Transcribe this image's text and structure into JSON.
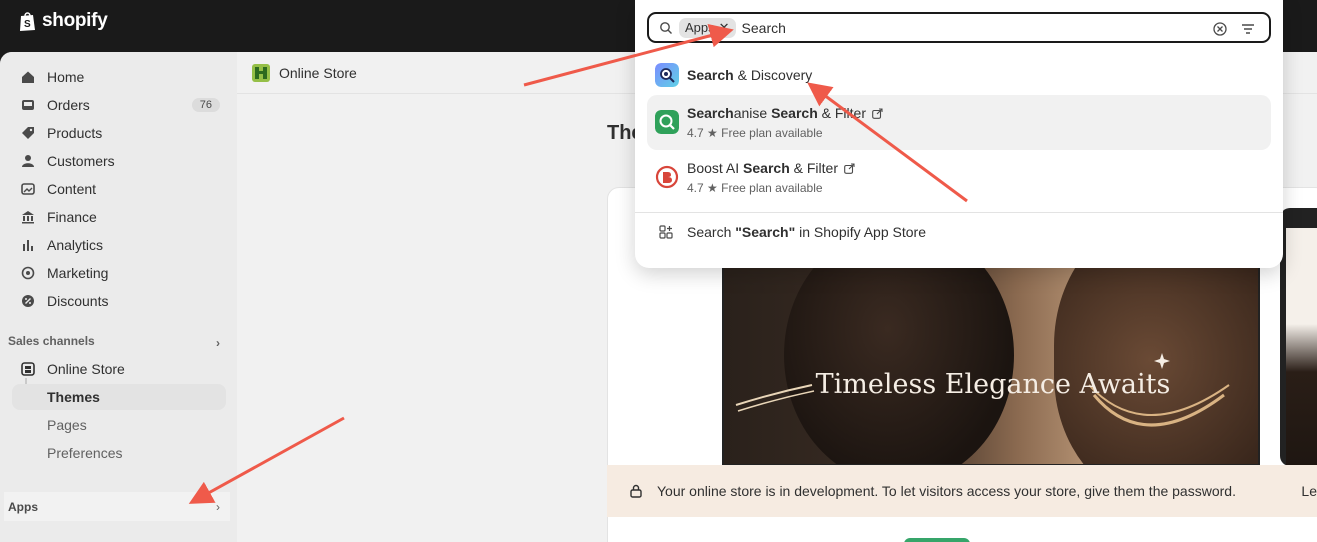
{
  "brand": {
    "name": "shopify"
  },
  "sidebar": {
    "items": [
      {
        "label": "Home",
        "icon": "home-icon"
      },
      {
        "label": "Orders",
        "icon": "inbox-icon",
        "badge": "76"
      },
      {
        "label": "Products",
        "icon": "tag-icon"
      },
      {
        "label": "Customers",
        "icon": "person-icon"
      },
      {
        "label": "Content",
        "icon": "image-icon"
      },
      {
        "label": "Finance",
        "icon": "bank-icon"
      },
      {
        "label": "Analytics",
        "icon": "bar-chart-icon"
      },
      {
        "label": "Marketing",
        "icon": "target-icon"
      },
      {
        "label": "Discounts",
        "icon": "discount-icon"
      }
    ],
    "sales_channels_label": "Sales channels",
    "online_store": {
      "label": "Online Store",
      "icon": "storefront-icon"
    },
    "sub_items": [
      {
        "label": "Themes"
      },
      {
        "label": "Pages"
      },
      {
        "label": "Preferences"
      }
    ],
    "apps_label": "Apps"
  },
  "main": {
    "header_title": "Online Store",
    "page_title": "The",
    "preview_heading": "Timeless Elegance Awaits",
    "notice_text": "Your online store is in development. To let visitors access your store, give them the password.",
    "notice_more": "Le"
  },
  "search": {
    "scope_chip": "Apps",
    "query": "Search",
    "results": [
      {
        "name_bold": "Search",
        "name_rest": " & Discovery",
        "icon_color": "#6c7bf2"
      },
      {
        "name_html_parts": [
          "Search",
          "anise ",
          "Search",
          " & Filter"
        ],
        "rating": "4.7",
        "plan": "Free plan available",
        "icon_color": "#2fa15a"
      },
      {
        "name_parts": [
          "Boost AI ",
          "Search",
          " & Filter"
        ],
        "rating": "4.7",
        "plan": "Free plan available",
        "icon_color": "#d8453a"
      }
    ],
    "store_search_prefix": "Search ",
    "store_search_bold": "\"Search\"",
    "store_search_suffix": " in Shopify App Store"
  },
  "colors": {
    "annotation_arrow": "#ef5a4a",
    "brand_green": "#36a56a"
  }
}
